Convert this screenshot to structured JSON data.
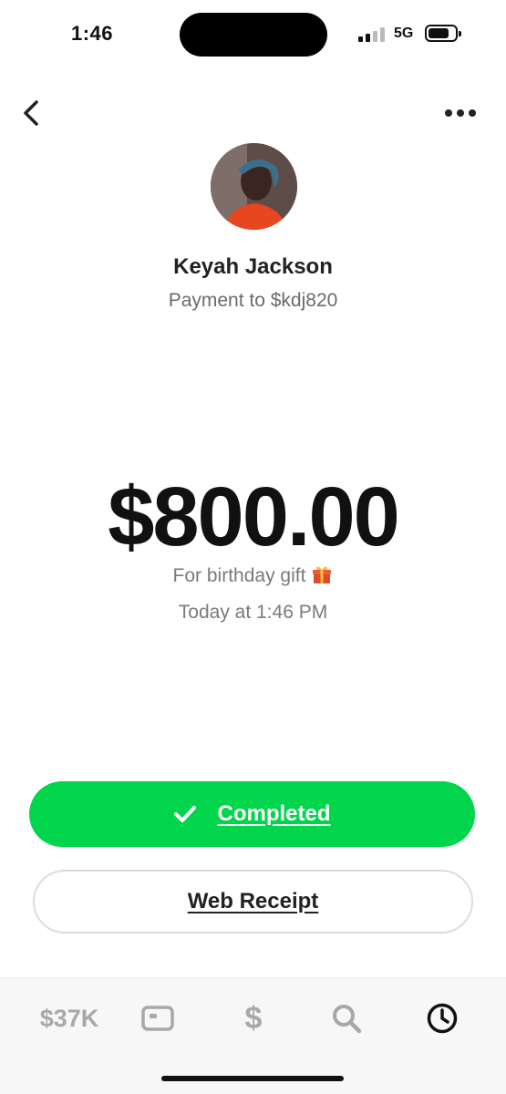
{
  "status_bar": {
    "time": "1:46",
    "network": "5G"
  },
  "header": {
    "back_icon": "chevron-left-icon",
    "more_icon": "more-horizontal-icon"
  },
  "recipient": {
    "name": "Keyah Jackson",
    "subtitle": "Payment to $kdj820"
  },
  "payment": {
    "amount": "$800.00",
    "note": "For birthday gift",
    "note_emoji": "gift-icon",
    "date": "Today at 1:46 PM"
  },
  "actions": {
    "completed_label": "Completed",
    "receipt_label": "Web Receipt"
  },
  "tab_bar": {
    "balance": "$37K",
    "pay_symbol": "$",
    "active_tab": "activity"
  },
  "colors": {
    "accent_green": "#00d54b",
    "tab_inactive": "#a8a8a8"
  }
}
